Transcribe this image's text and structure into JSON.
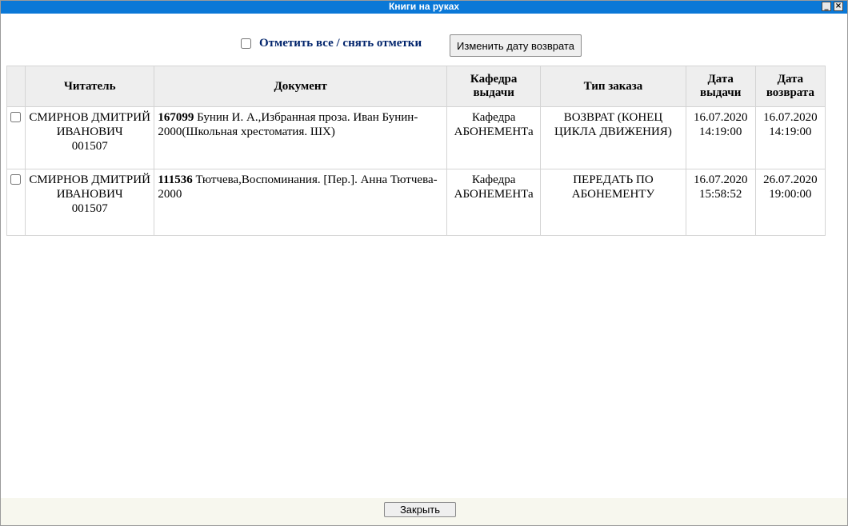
{
  "window": {
    "title": "Книги на руках",
    "minimize_symbol": "_",
    "close_symbol": "×"
  },
  "toolbar": {
    "mark_all_label": "Отметить все / снять отметки",
    "change_date_button": "Изменить дату возврата"
  },
  "table": {
    "headers": {
      "reader": "Читатель",
      "document": "Документ",
      "dept": "Кафедра выдачи",
      "order_type": "Тип заказа",
      "issue_date": "Дата выдачи",
      "return_date": "Дата возврата"
    },
    "rows": [
      {
        "reader_name": "СМИРНОВ ДМИТРИЙ ИВАНОВИЧ",
        "reader_id": "001507",
        "doc_id": "167099",
        "doc_text": " Бунин И. А.,Избранная проза. Иван Бунин- 2000(Школьная хрестоматия. ШХ)",
        "dept": "Кафедра АБОНЕМЕНТа",
        "order_type": "ВОЗВРАТ (КОНЕЦ ЦИКЛА ДВИЖЕНИЯ)",
        "issue_date": "16.07.2020",
        "issue_time": "14:19:00",
        "return_date": "16.07.2020",
        "return_time": "14:19:00"
      },
      {
        "reader_name": "СМИРНОВ ДМИТРИЙ ИВАНОВИЧ",
        "reader_id": "001507",
        "doc_id": "111536",
        "doc_text": " Тютчева,Воспоминания. [Пер.]. Анна Тютчева- 2000",
        "dept": "Кафедра АБОНЕМЕНТа",
        "order_type": "ПЕРЕДАТЬ ПО АБОНЕМЕНТУ",
        "issue_date": "16.07.2020",
        "issue_time": "15:58:52",
        "return_date": "26.07.2020",
        "return_time": "19:00:00"
      }
    ]
  },
  "footer": {
    "close_button": "Закрыть"
  },
  "colors": {
    "titlebar": "#0a78d7",
    "link_blue": "#00236b",
    "header_bg": "#eeeeee",
    "footer_bg": "#f7f7ee"
  }
}
